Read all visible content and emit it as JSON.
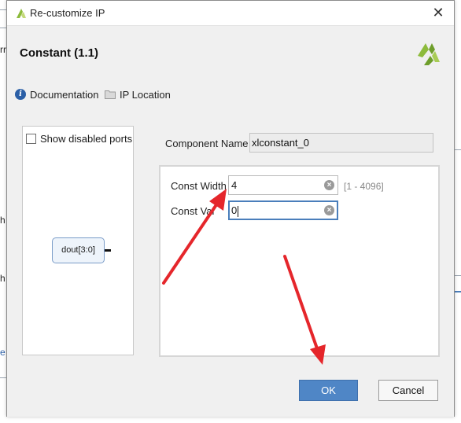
{
  "window": {
    "title": "Re-customize IP",
    "close_glyph": "✕"
  },
  "header": {
    "ip_title": "Constant (1.1)",
    "links": [
      {
        "label": "Documentation",
        "icon": "info-icon"
      },
      {
        "label": "IP Location",
        "icon": "folder-icon"
      }
    ]
  },
  "symbol_panel": {
    "show_disabled_ports_label": "Show disabled ports",
    "show_disabled_ports_checked": false,
    "port_label": "dout[3:0]"
  },
  "component": {
    "label": "Component Name",
    "value": "xlconstant_0"
  },
  "params": [
    {
      "label": "Const Width",
      "value": "4",
      "range": "[1 - 4096]"
    },
    {
      "label": "Const Val",
      "value": "0",
      "range": ""
    }
  ],
  "buttons": {
    "ok": "OK",
    "cancel": "Cancel"
  },
  "colors": {
    "accent": "#4f86c6",
    "annotation_arrow": "#e5262b",
    "brand_green": "#8dbb3c"
  },
  "background": {
    "letters": [
      "rr",
      "h",
      "h",
      "e"
    ]
  }
}
